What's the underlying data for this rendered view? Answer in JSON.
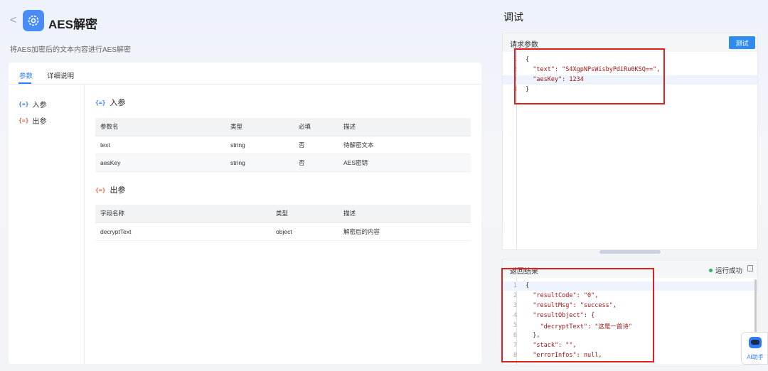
{
  "header": {
    "back_glyph": "<",
    "logo_icon": "gear-icon",
    "title": "AES解密",
    "description": "将AES加密后的文本内容进行AES解密"
  },
  "tabs": [
    {
      "label": "参数",
      "active": true
    },
    {
      "label": "详细说明",
      "active": false
    }
  ],
  "leftnav": {
    "items": [
      {
        "icon": "{=}",
        "label": "入参"
      },
      {
        "icon": "{=}",
        "label": "出参"
      }
    ]
  },
  "input_section": {
    "icon": "{=}",
    "title": "入参",
    "columns": [
      "参数名",
      "类型",
      "必填",
      "描述"
    ],
    "rows": [
      [
        "text",
        "string",
        "否",
        "待解密文本"
      ],
      [
        "aesKey",
        "string",
        "否",
        "AES密钥"
      ]
    ]
  },
  "output_section": {
    "icon": "{=}",
    "title": "出参",
    "columns": [
      "字段名称",
      "类型",
      "描述"
    ],
    "rows": [
      [
        "decryptText",
        "object",
        "解密后的内容"
      ]
    ]
  },
  "debug": {
    "title": "调试",
    "request": {
      "label": "请求参数",
      "test_button": "测试",
      "lines": [
        {
          "n": "1",
          "text": "{"
        },
        {
          "n": "2",
          "text": "  \"text\": \"S4XgpNPsWisbyPdiRu0KSQ==\","
        },
        {
          "n": "3",
          "text": "  \"aesKey\": 1234"
        },
        {
          "n": "4",
          "text": "}"
        }
      ]
    },
    "result": {
      "label": "返回结果",
      "status": "运行成功",
      "status_color": "#2eb35a",
      "lines": [
        {
          "n": "1",
          "text": "{"
        },
        {
          "n": "2",
          "text": "  \"resultCode\": \"0\","
        },
        {
          "n": "3",
          "text": "  \"resultMsg\": \"success\","
        },
        {
          "n": "4",
          "text": "  \"resultObject\": {"
        },
        {
          "n": "5",
          "text": "    \"decryptText\": \"这是一首诗\""
        },
        {
          "n": "6",
          "text": "  },"
        },
        {
          "n": "7",
          "text": "  \"stack\": \"\","
        },
        {
          "n": "8",
          "text": "  \"errorInfos\": null,"
        }
      ]
    }
  },
  "ai_assistant": {
    "label": "AI助手"
  },
  "colors": {
    "accent": "#2e7cf6",
    "annotation": "#e02020"
  }
}
